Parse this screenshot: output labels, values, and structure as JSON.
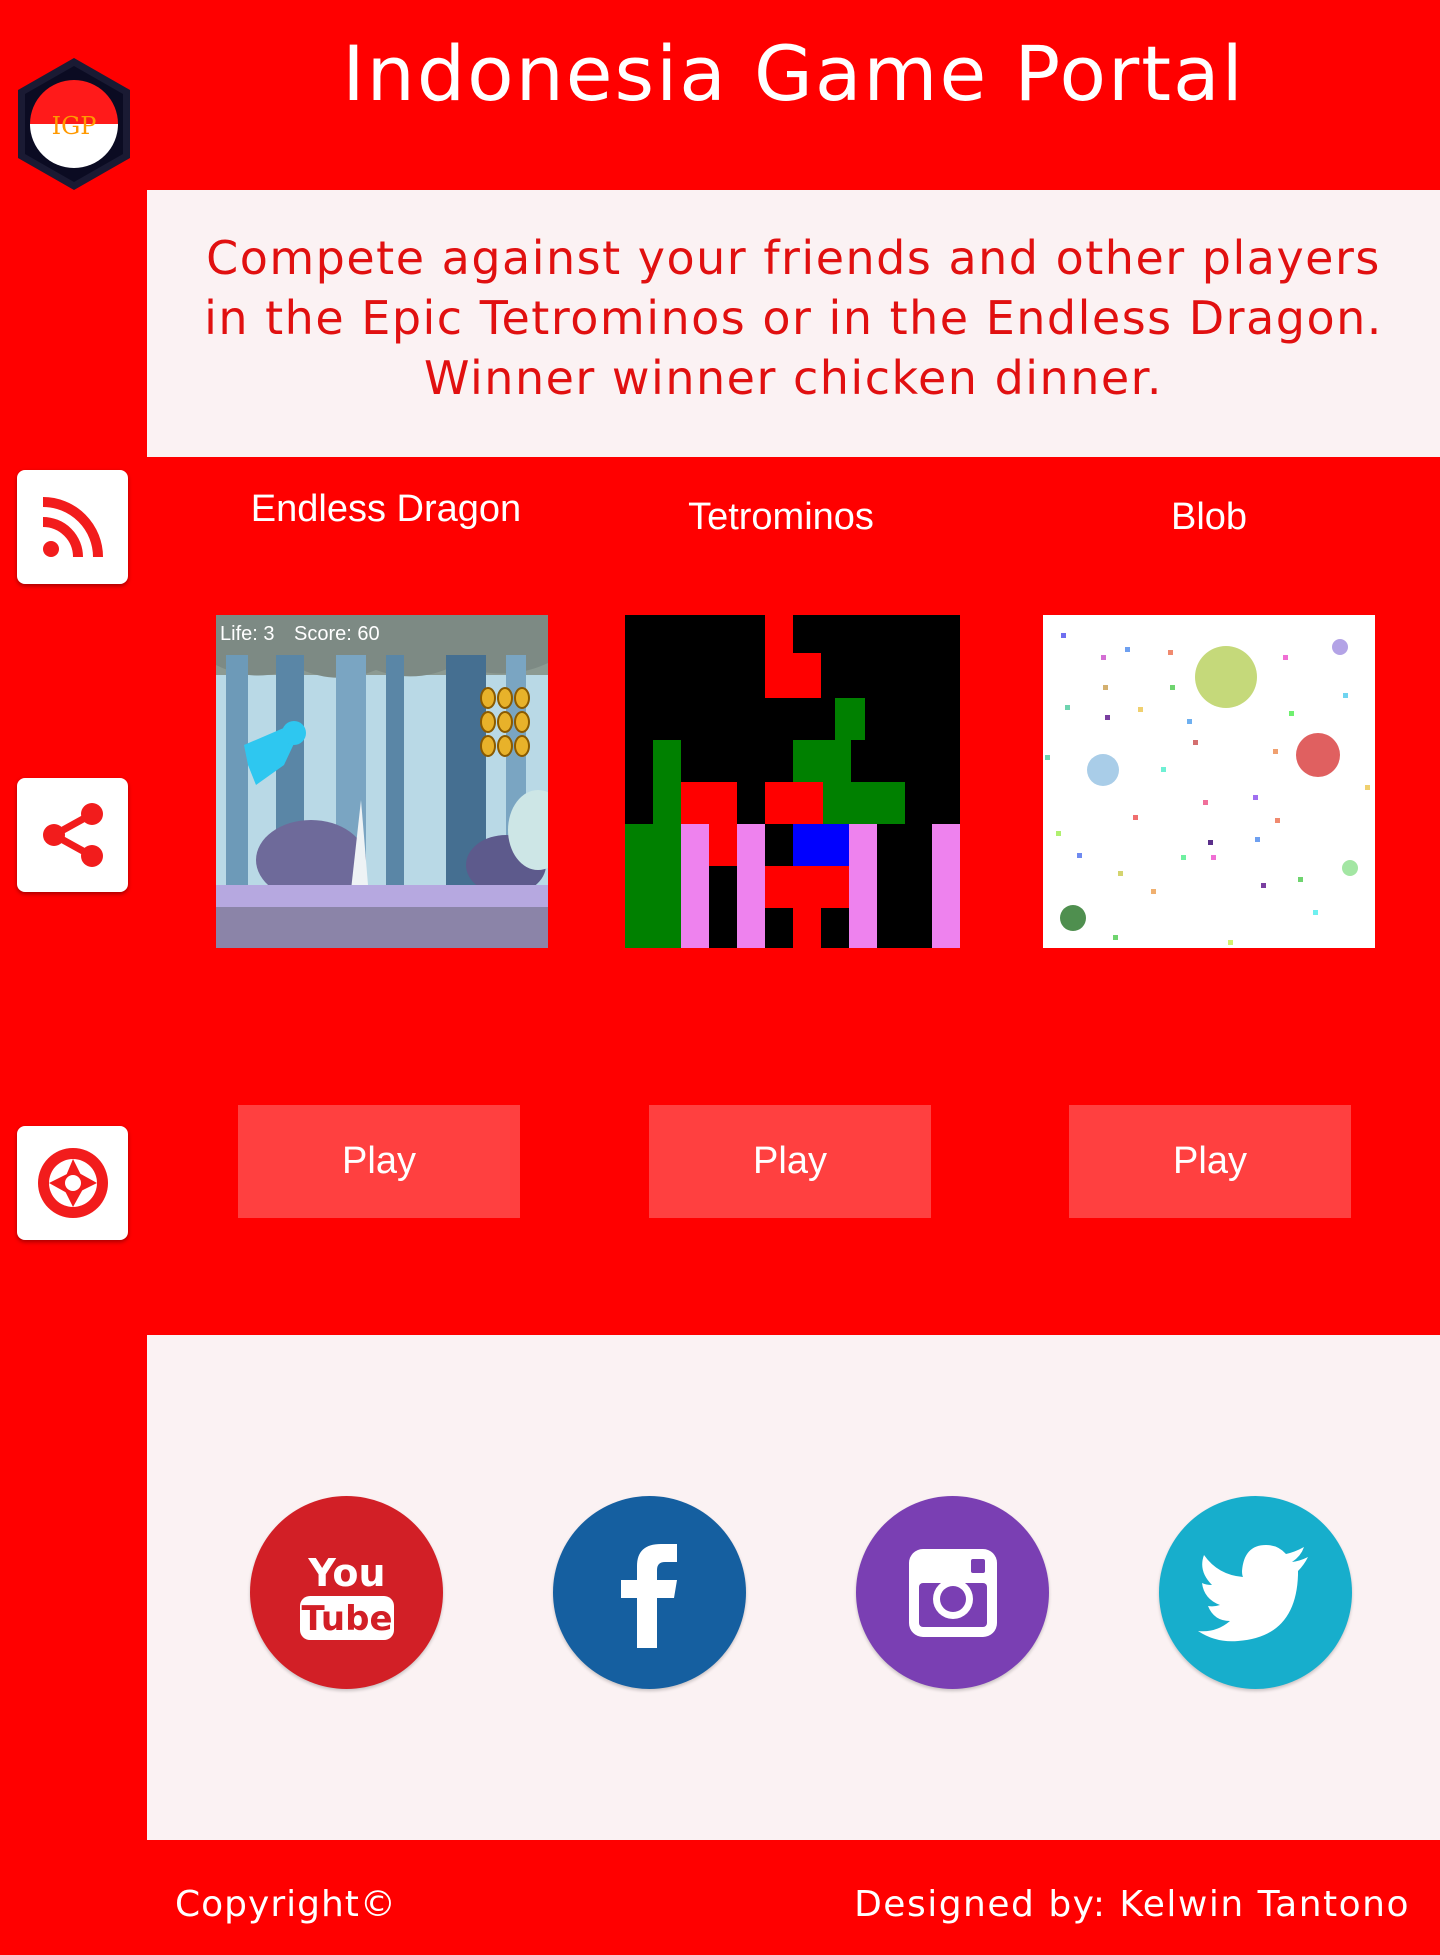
{
  "logo": {
    "text": "IGP"
  },
  "header": {
    "title": "Indonesia Game Portal"
  },
  "intro": {
    "lines": [
      "Compete against your friends and other players",
      "in the Epic Tetrominos or in the Endless Dragon.",
      "Winner winner chicken dinner."
    ]
  },
  "sidebar": {
    "items": [
      {
        "icon": "rss-icon"
      },
      {
        "icon": "share-icon"
      },
      {
        "icon": "aperture-icon"
      }
    ]
  },
  "games": [
    {
      "title": "Endless Dragon",
      "play_label": "Play",
      "hud_life": "Life: 3",
      "hud_score": "Score: 60"
    },
    {
      "title": "Tetrominos",
      "play_label": "Play"
    },
    {
      "title": "Blob",
      "play_label": "Play"
    }
  ],
  "social": {
    "youtube": {
      "line1": "You",
      "line2": "Tube",
      "color": "#d21f26"
    },
    "facebook": {
      "icon": "facebook-icon",
      "color": "#155fa0"
    },
    "instagram": {
      "icon": "instagram-icon",
      "color": "#7a3fb3"
    },
    "twitter": {
      "icon": "twitter-icon",
      "color": "#17aecc"
    }
  },
  "footer": {
    "copyright": "Copyright©",
    "designer": "Designed by: Kelwin Tantono"
  },
  "colors": {
    "brand_red": "#ff0000",
    "play_button": "#ff4040",
    "panel_bg": "#fbf2f3",
    "intro_text": "#e11010"
  }
}
